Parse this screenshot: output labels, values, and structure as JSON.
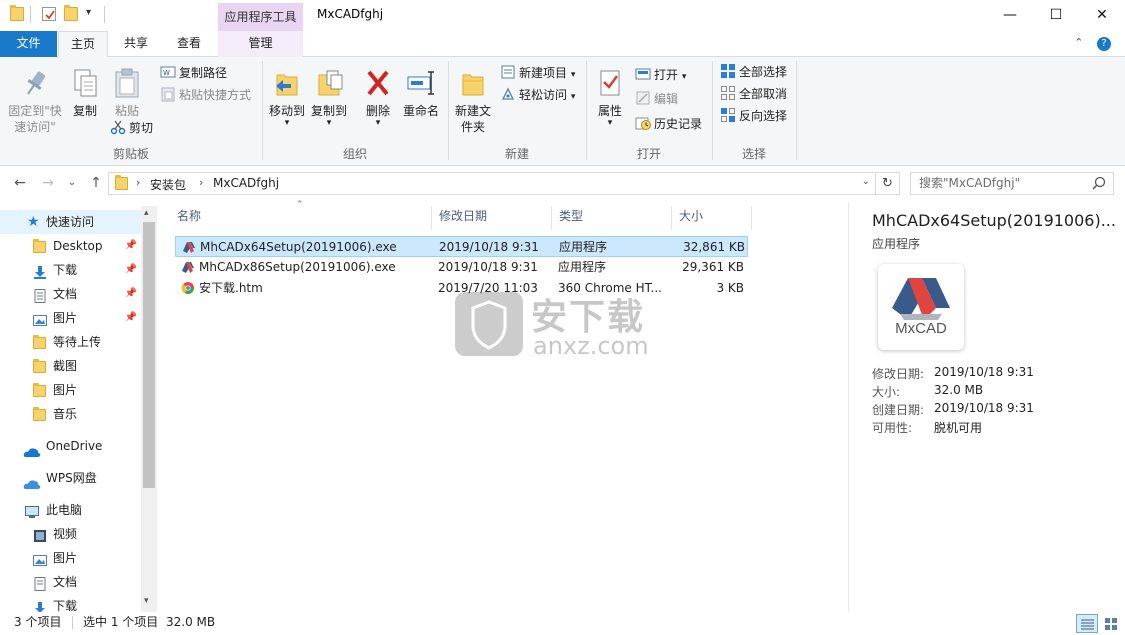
{
  "window": {
    "title": "MxCADfghj",
    "context_tab_title": "应用程序工具",
    "controls": {
      "minimize": "—",
      "maximize": "☐",
      "close": "✕"
    }
  },
  "tabs": {
    "file": "文件",
    "home": "主页",
    "share": "共享",
    "view": "查看",
    "manage": "管理"
  },
  "ribbon": {
    "clipboard": {
      "pin": "固定到\"快速访问\"",
      "copy": "复制",
      "paste": "粘贴",
      "copy_path": "复制路径",
      "paste_shortcut": "粘贴快捷方式",
      "cut": "剪切",
      "label": "剪贴板"
    },
    "organize": {
      "move_to": "移动到",
      "copy_to": "复制到",
      "delete": "删除",
      "rename": "重命名",
      "label": "组织"
    },
    "new": {
      "new_folder": "新建文件夹",
      "new_item": "新建项目",
      "easy_access": "轻松访问",
      "label": "新建"
    },
    "open": {
      "properties": "属性",
      "open": "打开",
      "edit": "编辑",
      "history": "历史记录",
      "label": "打开"
    },
    "select": {
      "select_all": "全部选择",
      "select_none": "全部取消",
      "invert": "反向选择",
      "label": "选择"
    }
  },
  "address": {
    "crumbs": [
      "安装包",
      "MxCADfghj"
    ],
    "search_placeholder": "搜索\"MxCADfghj\""
  },
  "navpane": {
    "quick_access": "快速访问",
    "items": [
      {
        "label": "Desktop",
        "pinned": true
      },
      {
        "label": "下载",
        "pinned": true
      },
      {
        "label": "文档",
        "pinned": true
      },
      {
        "label": "图片",
        "pinned": true
      },
      {
        "label": "等待上传",
        "pinned": false
      },
      {
        "label": "截图",
        "pinned": false
      },
      {
        "label": "图片",
        "pinned": false
      },
      {
        "label": "音乐",
        "pinned": false
      }
    ],
    "onedrive": "OneDrive",
    "wps": "WPS网盘",
    "this_pc": "此电脑",
    "pc_items": [
      "视频",
      "图片",
      "文档",
      "下载"
    ]
  },
  "filelist": {
    "columns": {
      "name": "名称",
      "modified": "修改日期",
      "type": "类型",
      "size": "大小"
    },
    "files": [
      {
        "name": "MhCADx64Setup(20191006).exe",
        "modified": "2019/10/18 9:31",
        "type": "应用程序",
        "size": "32,861 KB",
        "selected": true
      },
      {
        "name": "MhCADx86Setup(20191006).exe",
        "modified": "2019/10/18 9:31",
        "type": "应用程序",
        "size": "29,361 KB",
        "selected": false
      },
      {
        "name": "安下载.htm",
        "modified": "2019/7/20 11:03",
        "type": "360 Chrome HT...",
        "size": "3 KB",
        "selected": false
      }
    ]
  },
  "watermark": {
    "big": "安下载",
    "small": "anxz.com"
  },
  "details": {
    "filename": "MhCADx64Setup(20191006)...",
    "filetype": "应用程序",
    "logo_text": "MxCAD",
    "rows": [
      {
        "label": "修改日期:",
        "value": "2019/10/18 9:31"
      },
      {
        "label": "大小:",
        "value": "32.0 MB"
      },
      {
        "label": "创建日期:",
        "value": "2019/10/18 9:31"
      },
      {
        "label": "可用性:",
        "value": "脱机可用"
      }
    ]
  },
  "statusbar": {
    "count": "3 个项目",
    "selection": "选中 1 个项目",
    "size": "32.0 MB"
  },
  "colors": {
    "file_tab": "#1979ca",
    "selection": "#cce8ff",
    "context_tab": "#e8d5f2"
  }
}
